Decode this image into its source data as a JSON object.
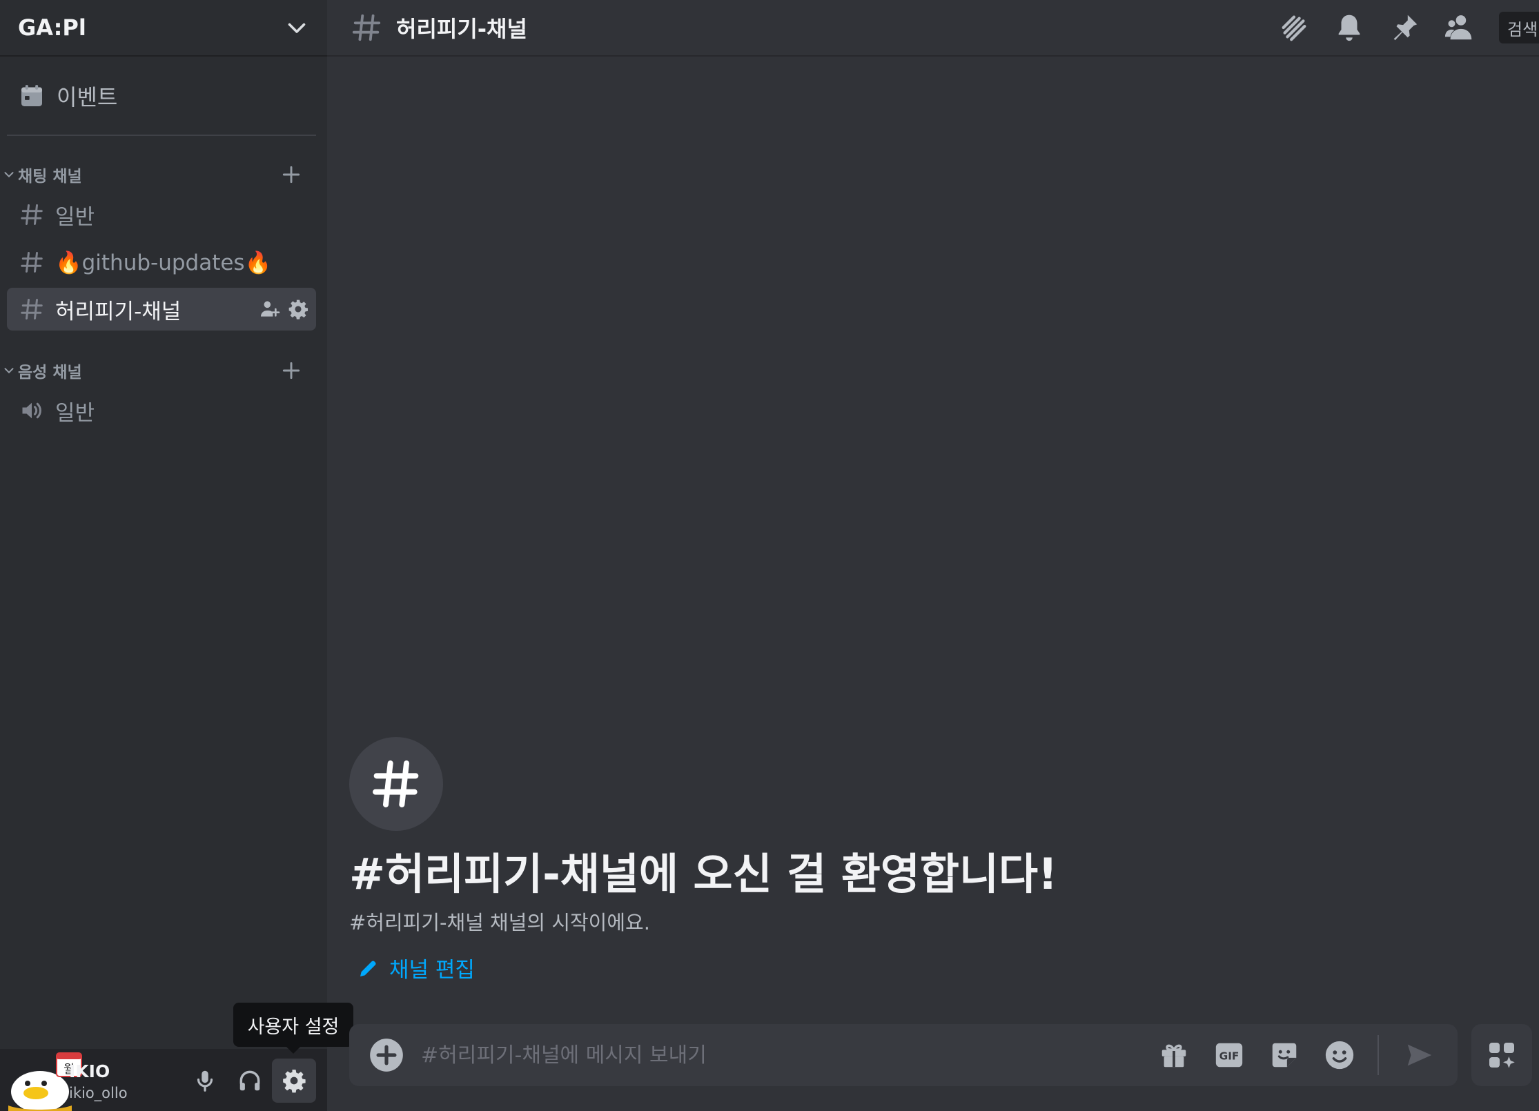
{
  "server": {
    "name": "GA:Pl"
  },
  "sidebar": {
    "events_label": "이벤트",
    "categories": [
      {
        "label": "채팅 채널"
      },
      {
        "label": "음성 채널"
      }
    ],
    "text_channels": [
      {
        "label": "일반"
      },
      {
        "label": "🔥github-updates🔥"
      },
      {
        "label": "허리피기-채널"
      }
    ],
    "voice_channels": [
      {
        "label": "일반"
      }
    ]
  },
  "header": {
    "title": "허리피기-채널",
    "search_label": "검색"
  },
  "welcome": {
    "title": "#허리피기-채널에 오신 걸 환영합니다!",
    "subtitle": "#허리피기-채널 채널의 시작이에요.",
    "edit_label": "채널 편집"
  },
  "composer": {
    "placeholder": "#허리피기-채널에 메시지 보내기",
    "value": ""
  },
  "user": {
    "display_name": "IKIO",
    "username": "ikio_ollo",
    "calendar_badge": "월",
    "tooltip": "사용자 설정"
  },
  "colors": {
    "sidebar_bg": "#2b2d31",
    "chat_bg": "#313338",
    "selected_channel": "#404249",
    "link": "#00a8fc",
    "user_panel_bg": "#232428"
  },
  "icons": {
    "header": [
      "threads-icon",
      "bell-icon",
      "pin-icon",
      "members-icon"
    ],
    "composer": [
      "gift-icon",
      "gif-icon",
      "sticker-icon",
      "emoji-icon",
      "send-icon"
    ]
  }
}
